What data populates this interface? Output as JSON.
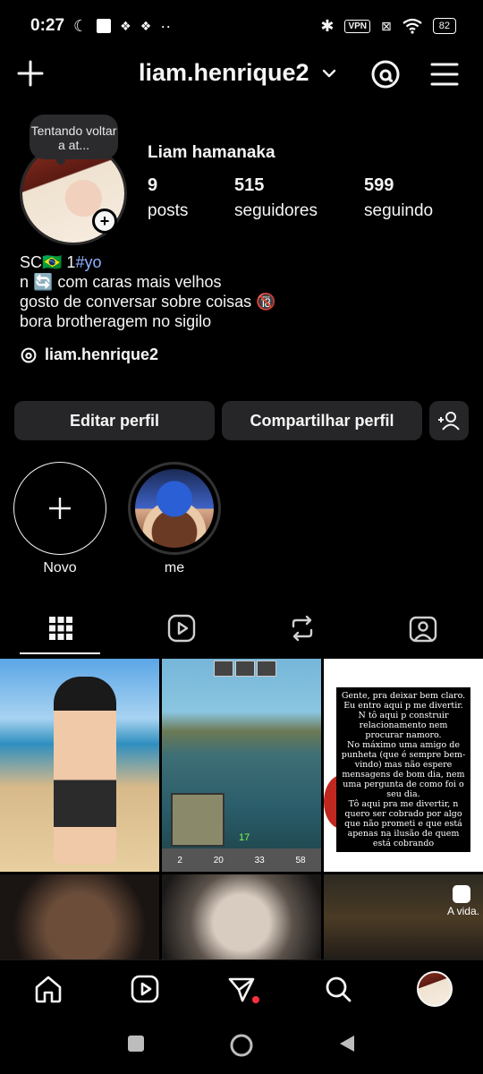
{
  "status_bar": {
    "time": "0:27",
    "vpn_label": "VPN",
    "battery": "82"
  },
  "header": {
    "username": "liam.henrique2"
  },
  "profile": {
    "note": "Tentando voltar a at...",
    "full_name": "Liam hamanaka",
    "stats": [
      {
        "value": "9",
        "label": "posts"
      },
      {
        "value": "515",
        "label": "seguidores"
      },
      {
        "value": "599",
        "label": "seguindo"
      }
    ],
    "bio": {
      "line1_prefix": "SC🇧🇷 1",
      "line1_hashtag": "#yo",
      "line2": "n 🔄 com caras mais velhos",
      "line3": "gosto de conversar sobre coisas 🔞",
      "line4": "bora brotheragem no sigilo"
    },
    "threads_handle": "liam.henrique2"
  },
  "actions": {
    "edit_label": "Editar perfil",
    "share_label": "Compartilhar perfil"
  },
  "highlights": [
    {
      "label": "Novo"
    },
    {
      "label": "me"
    }
  ],
  "tabs": [
    {
      "name": "grid",
      "icon": "grid-icon",
      "active": true
    },
    {
      "name": "reels",
      "icon": "reels-icon",
      "active": false
    },
    {
      "name": "reposts",
      "icon": "repost-icon",
      "active": false
    },
    {
      "name": "tagged",
      "icon": "tagged-icon",
      "active": false
    }
  ],
  "posts": {
    "text_post": "Gente, pra deixar bem claro. Eu entro aqui p me divertir.\nN tô aqui p construir relacionamento nem procurar namoro.\nNo máximo uma amigo de punheta (que é sempre bem-vindo) mas não espere mensagens de bom dia, nem uma pergunta de como foi o seu dia.\nTô aqui pra me divertir, n quero ser cobrado por algo que não prometi e que está apenas na ilusão de quem está cobrando",
    "minecraft_level": "17",
    "minecraft_hud": [
      "2",
      "20",
      "33",
      "58"
    ],
    "vida_label": "A vida."
  },
  "colors": {
    "background": "#000000",
    "button_bg": "#262628",
    "hashtag": "#8fb0ff",
    "notification_dot": "#ff3040"
  }
}
